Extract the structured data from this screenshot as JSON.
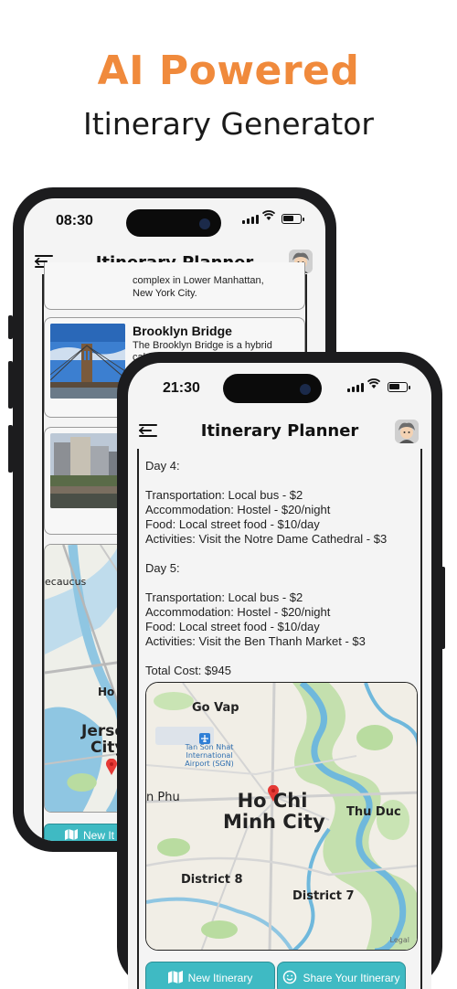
{
  "hero": {
    "title": "AI Powered",
    "subtitle": "Itinerary Generator",
    "title_color": "#f08a3c"
  },
  "back_phone": {
    "time": "08:30",
    "app_title": "Itinerary Planner",
    "partial_card_text": [
      "complex in Lower Manhattan,",
      "New York City."
    ],
    "cards": [
      {
        "name": "Brooklyn Bridge",
        "description": "The Brooklyn Bridge is a hybrid cable-stayed/suspension bridge in"
      }
    ],
    "map_labels": [
      "ecaucus",
      "Ho",
      "Jerse",
      "City"
    ],
    "button_label": "New It"
  },
  "front_phone": {
    "time": "21:30",
    "app_title": "Itinerary Planner",
    "itinerary_lines": [
      "Day 4:",
      "",
      "Transportation: Local bus - $2",
      "Accommodation: Hostel - $20/night",
      "Food: Local street food - $10/day",
      "Activities: Visit the Notre Dame Cathedral - $3",
      "",
      "Day 5:",
      "",
      "Transportation: Local bus - $2",
      "Accommodation: Hostel - $20/night",
      "Food: Local street food - $10/day",
      "Activities: Visit the Ben Thanh Market - $3",
      "",
      "Total Cost: $945"
    ],
    "map": {
      "city": "Ho Chi Minh City",
      "city_line1": "Ho Chi",
      "city_line2": "Minh City",
      "labels": {
        "go_vap": "Go Vap",
        "airport_line1": "Tan Son Nhat",
        "airport_line2": "International",
        "airport_line3": "Airport (SGN)",
        "phu": "n Phu",
        "thu_duc": "Thu Duc",
        "district8": "District 8",
        "district7": "District 7",
        "legal": "Legal"
      }
    },
    "buttons": {
      "new_itinerary": "New Itinerary",
      "share": "Share Your Itinerary"
    }
  },
  "colors": {
    "accent": "#3fbac3",
    "marker": "#e53935",
    "water": "#6fb8dc",
    "park": "#b9dca0"
  }
}
